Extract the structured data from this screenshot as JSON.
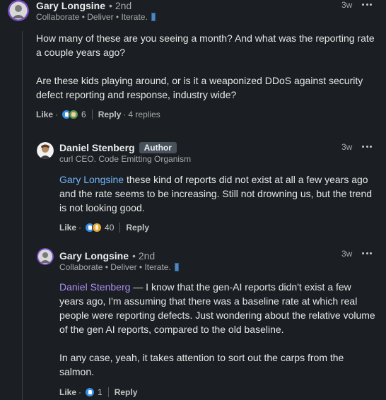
{
  "comments": [
    {
      "author": "Gary Longsine",
      "degree": "• 2nd",
      "tagline": "Collaborate • Deliver • Iterate.",
      "time": "3w",
      "paragraphs": [
        "How many of these are you seeing a month? And what was the reporting rate a couple years ago?",
        "Are these kids playing around, or is it a weaponized DDoS against security defect reporting and response, industry wide?"
      ],
      "like_label": "Like",
      "reaction_count": "6",
      "reply_label": "Reply",
      "replies_text": "4 replies"
    },
    {
      "author": "Daniel Stenberg",
      "badge": "Author",
      "tagline": "curl CEO. Code Emitting Organism",
      "time": "3w",
      "mention": "Gary Longsine",
      "text": " these kind of reports did not exist at all a few years ago and the rate seems to be increasing. Still not drowning us, but the trend is not looking good.",
      "like_label": "Like",
      "reaction_count": "40",
      "reply_label": "Reply"
    },
    {
      "author": "Gary Longsine",
      "degree": "• 2nd",
      "tagline": "Collaborate • Deliver • Iterate.",
      "time": "3w",
      "mention": "Daniel Stenberg",
      "text": " — I know that the gen-AI reports didn't exist a few years ago, I'm assuming that there was a baseline rate at which real people were reporting defects. Just wondering about the relative volume of the gen AI reports, compared to the old baseline.",
      "paragraph2": "In any case, yeah, it takes attention to sort out the carps from the salmon.",
      "like_label": "Like",
      "reaction_count": "1",
      "reply_label": "Reply"
    }
  ],
  "icons": {
    "more": "more-options-icon",
    "like_reaction": "like-reaction-icon",
    "clap_reaction": "celebrate-reaction-icon",
    "insight_reaction": "insightful-reaction-icon"
  },
  "colors": {
    "background": "#1b1f23",
    "mention_blue": "#70b5f9",
    "mention_purple": "#a98ff0",
    "author_badge": "#48505a"
  }
}
